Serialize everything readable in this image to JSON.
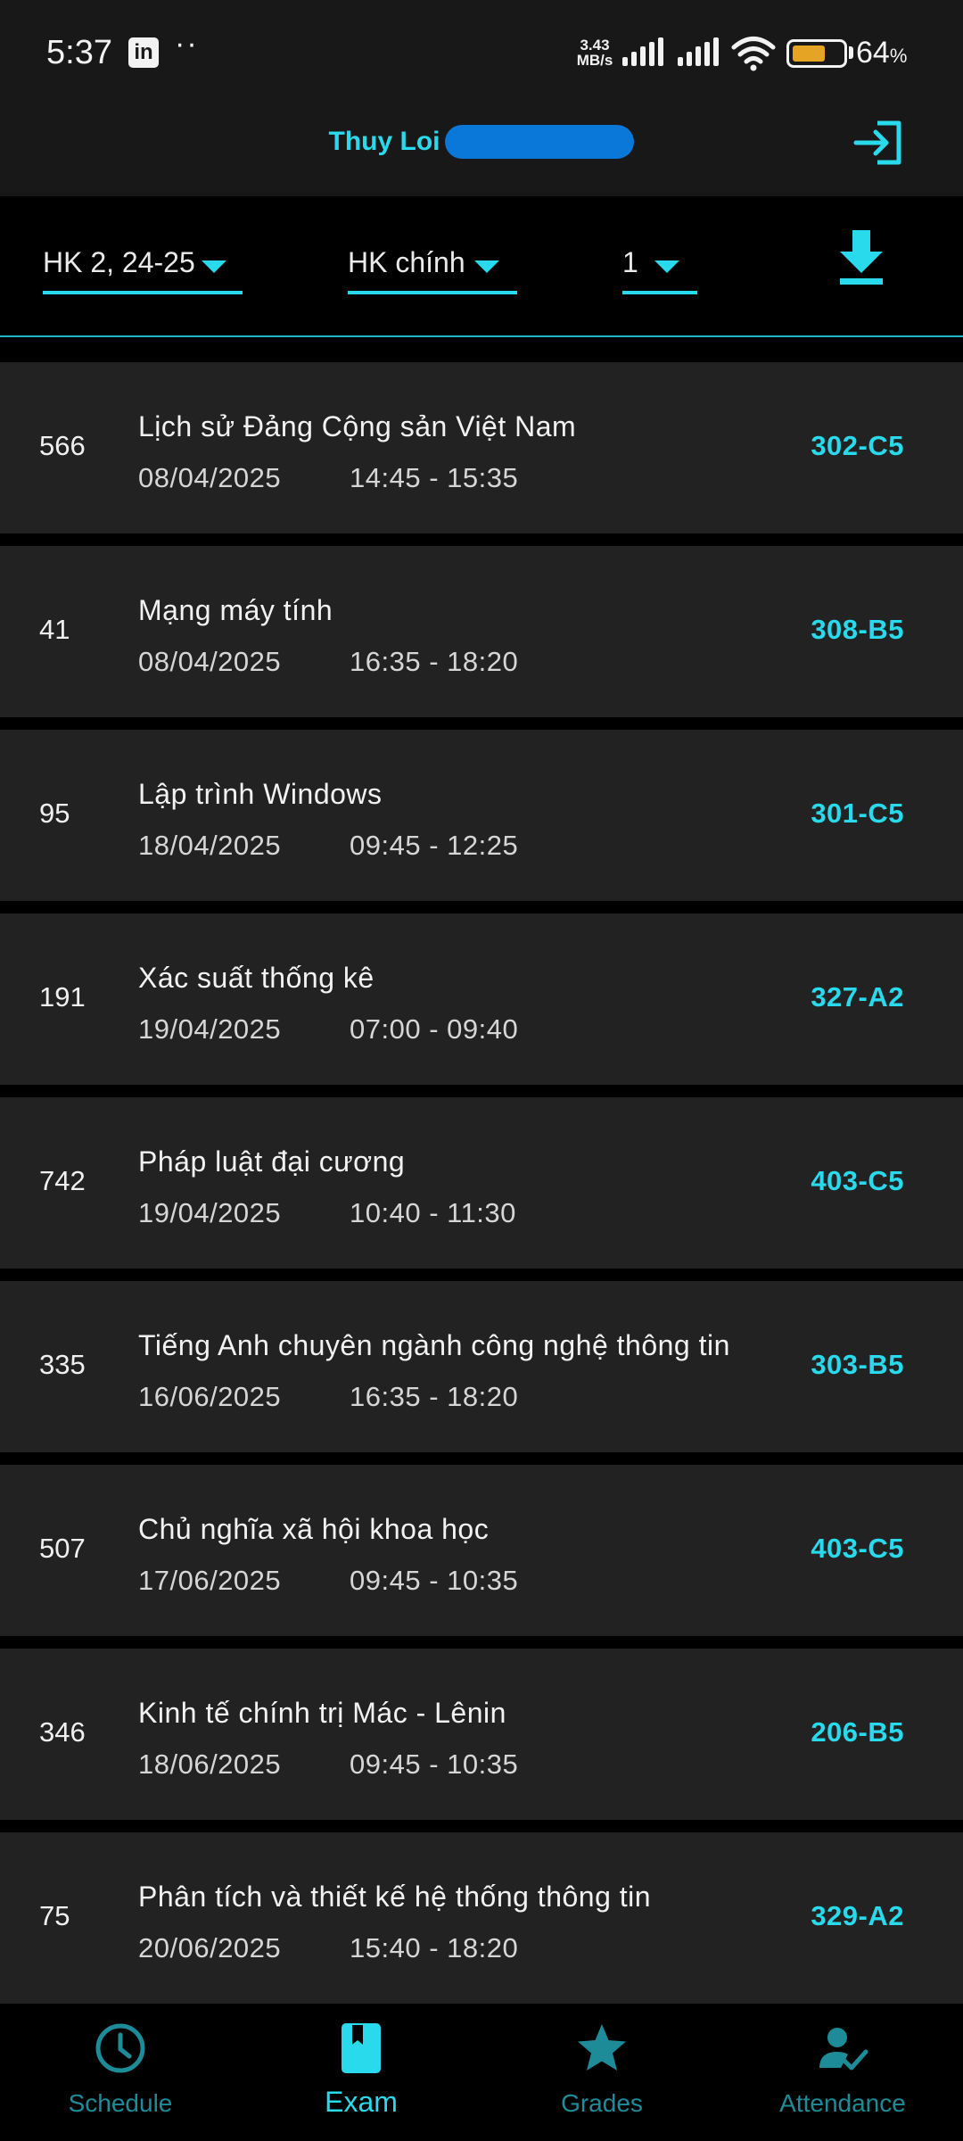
{
  "status_bar": {
    "time": "5:37",
    "notification_icons": [
      "linkedin-icon",
      "more-dots-icon"
    ],
    "net_speed_value": "3.43",
    "net_speed_unit": "MB/s",
    "battery_percent": "64",
    "battery_unit": "%",
    "battery_level": 0.64,
    "battery_color": "#e6a424"
  },
  "header": {
    "user_name": "Thuy Loi",
    "logout_icon": "logout-icon"
  },
  "filters": {
    "semester": "HK 2, 24-25",
    "exam_type": "HK chính",
    "round": "1",
    "download_icon": "download-icon"
  },
  "exams": [
    {
      "seat": "566",
      "subject": "Lịch sử Đảng Cộng sản Việt Nam",
      "date": "08/04/2025",
      "time": "14:45 - 15:35",
      "room": "302-C5"
    },
    {
      "seat": "41",
      "subject": "Mạng máy tính",
      "date": "08/04/2025",
      "time": "16:35 - 18:20",
      "room": "308-B5"
    },
    {
      "seat": "95",
      "subject": "Lập trình Windows",
      "date": "18/04/2025",
      "time": "09:45 - 12:25",
      "room": "301-C5"
    },
    {
      "seat": "191",
      "subject": "Xác suất thống kê",
      "date": "19/04/2025",
      "time": "07:00 - 09:40",
      "room": "327-A2"
    },
    {
      "seat": "742",
      "subject": "Pháp luật đại cương",
      "date": "19/04/2025",
      "time": "10:40 - 11:30",
      "room": "403-C5"
    },
    {
      "seat": "335",
      "subject": "Tiếng Anh chuyên ngành công nghệ thông tin",
      "date": "16/06/2025",
      "time": "16:35 - 18:20",
      "room": "303-B5"
    },
    {
      "seat": "507",
      "subject": "Chủ nghĩa xã hội khoa học",
      "date": "17/06/2025",
      "time": "09:45 - 10:35",
      "room": "403-C5"
    },
    {
      "seat": "346",
      "subject": "Kinh tế chính trị Mác - Lênin",
      "date": "18/06/2025",
      "time": "09:45 - 10:35",
      "room": "206-B5"
    },
    {
      "seat": "75",
      "subject": "Phân tích và thiết kế hệ thống thông tin",
      "date": "20/06/2025",
      "time": "15:40 - 18:20",
      "room": "329-A2"
    }
  ],
  "bottom_nav": [
    {
      "label": "Schedule",
      "icon": "clock-icon",
      "active": false
    },
    {
      "label": "Exam",
      "icon": "book-icon",
      "active": true
    },
    {
      "label": "Grades",
      "icon": "star-icon",
      "active": false
    },
    {
      "label": "Attendance",
      "icon": "person-check-icon",
      "active": false
    }
  ],
  "colors": {
    "accent": "#29d9ec",
    "card_background": "#222222",
    "background": "#000000",
    "nav_inactive": "#1d8c98"
  }
}
